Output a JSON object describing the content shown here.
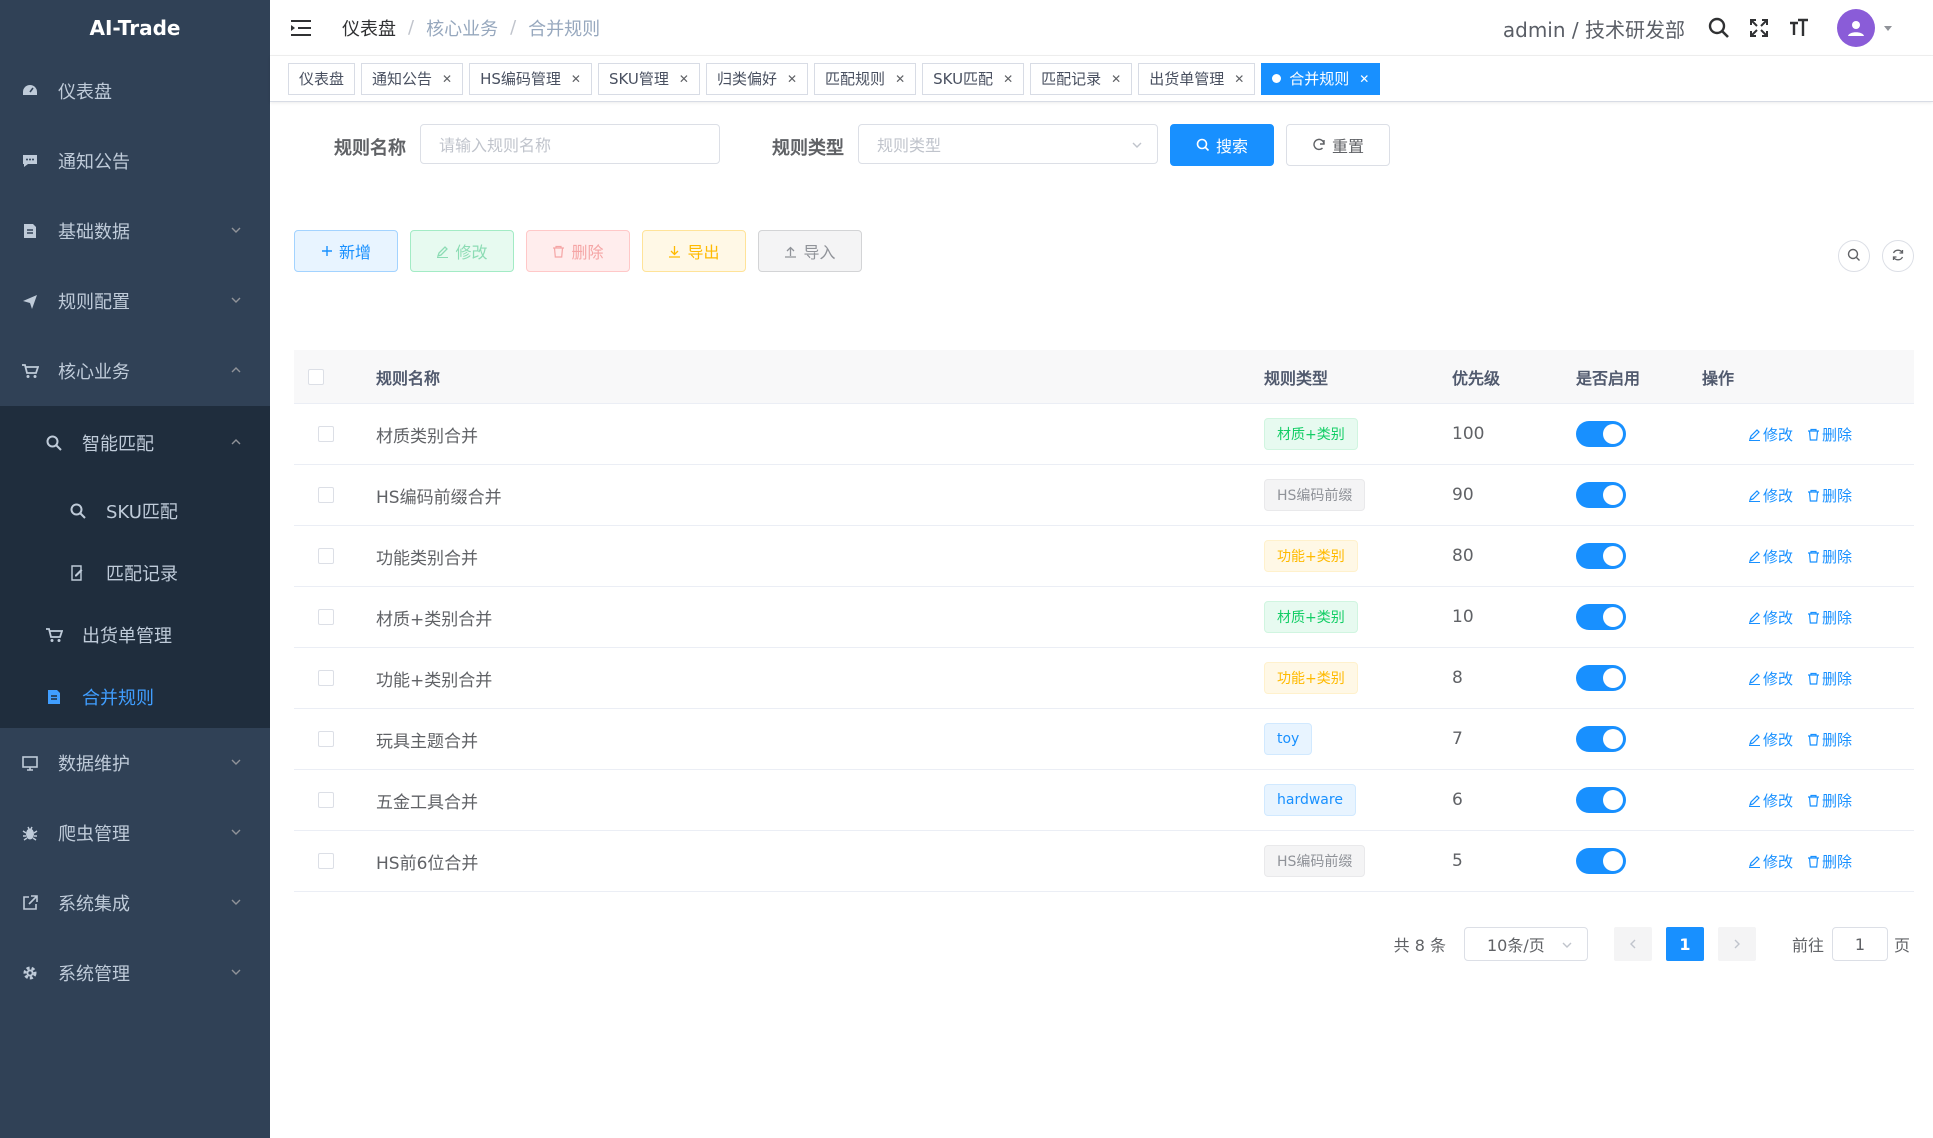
{
  "app": {
    "title": "AI-Trade"
  },
  "sidebar": {
    "items": [
      {
        "label": "仪表盘",
        "icon": "dashboard-icon"
      },
      {
        "label": "通知公告",
        "icon": "message-icon"
      },
      {
        "label": "基础数据",
        "icon": "document-icon"
      },
      {
        "label": "规则配置",
        "icon": "send-icon"
      },
      {
        "label": "核心业务",
        "icon": "shopping-cart-icon"
      }
    ],
    "core_sub": {
      "smart_match": "智能匹配",
      "sku_match": "SKU匹配",
      "match_record": "匹配记录",
      "shipment": "出货单管理",
      "merge_rules": "合并规则"
    },
    "items_bottom": [
      {
        "label": "数据维护",
        "icon": "monitor-icon"
      },
      {
        "label": "爬虫管理",
        "icon": "bug-icon"
      },
      {
        "label": "系统集成",
        "icon": "external-link-icon"
      },
      {
        "label": "系统管理",
        "icon": "gear-icon"
      }
    ]
  },
  "header": {
    "breadcrumb": [
      "仪表盘",
      "核心业务",
      "合并规则"
    ],
    "user": "admin / 技术研发部"
  },
  "tags": [
    "仪表盘",
    "通知公告",
    "HS编码管理",
    "SKU管理",
    "归类偏好",
    "匹配规则",
    "SKU匹配",
    "匹配记录",
    "出货单管理",
    "合并规则"
  ],
  "search": {
    "rule_name_label": "规则名称",
    "rule_name_placeholder": "请输入规则名称",
    "rule_type_label": "规则类型",
    "rule_type_placeholder": "规则类型",
    "search_label": "搜索",
    "reset_label": "重置"
  },
  "toolbar": {
    "add": "新增",
    "edit": "修改",
    "delete": "删除",
    "export": "导出",
    "import": "导入"
  },
  "table": {
    "columns": [
      "规则名称",
      "规则类型",
      "优先级",
      "是否启用",
      "操作"
    ],
    "edit_label": "修改",
    "delete_label": "删除",
    "rows": [
      {
        "name": "材质类别合并",
        "type": "材质+类别",
        "type_color": "green",
        "priority": "100",
        "enabled": true
      },
      {
        "name": "HS编码前缀合并",
        "type": "HS编码前缀",
        "type_color": "gray",
        "priority": "90",
        "enabled": true
      },
      {
        "name": "功能类别合并",
        "type": "功能+类别",
        "type_color": "orange",
        "priority": "80",
        "enabled": true
      },
      {
        "name": "材质+类别合并",
        "type": "材质+类别",
        "type_color": "green",
        "priority": "10",
        "enabled": true
      },
      {
        "name": "功能+类别合并",
        "type": "功能+类别",
        "type_color": "orange",
        "priority": "8",
        "enabled": true
      },
      {
        "name": "玩具主题合并",
        "type": "toy",
        "type_color": "blue",
        "priority": "7",
        "enabled": true
      },
      {
        "name": "五金工具合并",
        "type": "hardware",
        "type_color": "blue",
        "priority": "6",
        "enabled": true
      },
      {
        "name": "HS前6位合并",
        "type": "HS编码前缀",
        "type_color": "gray",
        "priority": "5",
        "enabled": true
      }
    ]
  },
  "pagination": {
    "total": "共 8 条",
    "page_size": "10条/页",
    "current_page": "1",
    "goto_label": "前往",
    "goto_value": "1",
    "page_suffix": "页"
  },
  "colors": {
    "sidebar_bg": "#304156",
    "submenu_bg": "#1f2d3d",
    "primary": "#1890ff",
    "active_text": "#409eff"
  }
}
